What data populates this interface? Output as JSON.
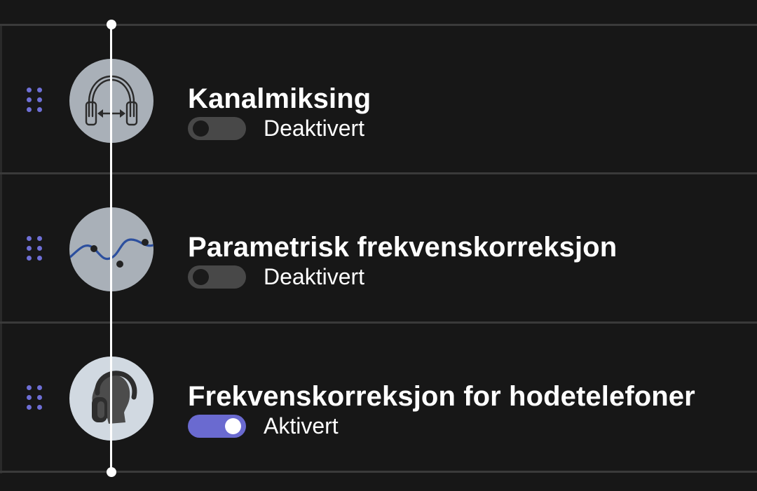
{
  "effects": [
    {
      "title": "Kanalmiksing",
      "status": "Deaktivert",
      "enabled": false,
      "icon": "headphones-channel-mix-icon"
    },
    {
      "title": "Parametrisk frekvenskorreksjon",
      "status": "Deaktivert",
      "enabled": false,
      "icon": "parametric-eq-curve-icon"
    },
    {
      "title": "Frekvenskorreksjon for hodetelefoner",
      "status": "Aktivert",
      "enabled": true,
      "icon": "headphones-head-icon"
    }
  ],
  "colors": {
    "background": "#171717",
    "accent": "#6a6ad0",
    "handle": "#6e6fd6",
    "icon_bg_inactive": "#a9b0b8",
    "icon_bg_active": "#d1d9e1"
  }
}
